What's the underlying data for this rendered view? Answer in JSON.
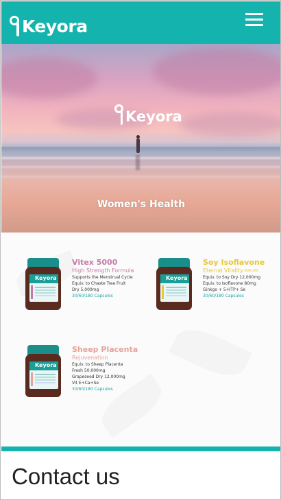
{
  "header": {
    "logo_text": "Keyora",
    "menu_icon": "hamburger-menu-icon",
    "color": "#14b3ad"
  },
  "hero": {
    "logo_text": "Keyora",
    "title": "Women's Health"
  },
  "products": [
    {
      "name": "Vitex 5000",
      "subtitle": "High Strength Formula",
      "name_color": "#c47aa8",
      "lines": [
        "Supports the Menstrual Cycle",
        "Equiv. to Chaste Tree Fruit",
        "Dry 5,000mg"
      ],
      "capsules": "30/60/180 Capsules",
      "brand": "Keyora"
    },
    {
      "name": "Soy Isoflavone",
      "subtitle": "Eternal Vitality",
      "badge": "NON GMO",
      "name_color": "#e8c53a",
      "lines": [
        "Equiv. to Soy Dry 12,000mg",
        "Equiv. to Isoflavone 80mg",
        "Ginkgo + 5-HTP+ Se"
      ],
      "capsules": "30/60/180 Capsules",
      "brand": "Keyora"
    },
    {
      "name": "Sheep Placenta",
      "subtitle": "Rejuvenation",
      "name_color": "#e7a39a",
      "lines": [
        "Equiv. to Sheep Placenta",
        "Fresh 50,000mg",
        "Grapeseed Dry 12,000mg",
        "Vit E+Ca+Se"
      ],
      "capsules": "30/60/180 Capsules",
      "brand": "Keyora"
    }
  ],
  "contact": {
    "heading": "Contact us"
  }
}
